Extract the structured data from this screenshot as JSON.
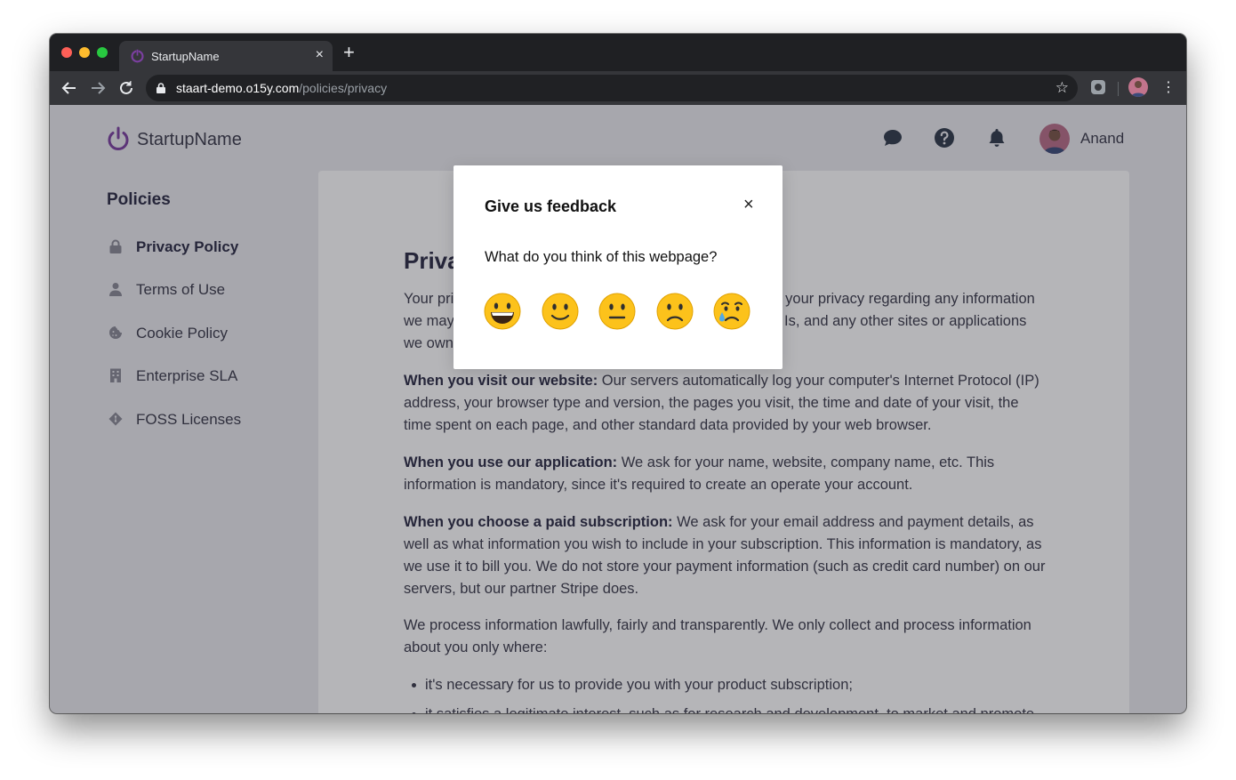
{
  "browser": {
    "tab_title": "StartupName",
    "url_domain": "staart-demo.o15y.com",
    "url_path": "/policies/privacy",
    "new_tab_label": "+",
    "close_tab_label": "×"
  },
  "header": {
    "brand": "StartupName",
    "user_name": "Anand",
    "icons": [
      "chat-icon",
      "help-icon",
      "bell-icon"
    ]
  },
  "sidebar": {
    "title": "Policies",
    "items": [
      {
        "label": "Privacy Policy",
        "icon": "lock-icon",
        "active": true
      },
      {
        "label": "Terms of Use",
        "icon": "user-icon",
        "active": false
      },
      {
        "label": "Cookie Policy",
        "icon": "cookie-icon",
        "active": false
      },
      {
        "label": "Enterprise SLA",
        "icon": "building-icon",
        "active": false
      },
      {
        "label": "FOSS Licenses",
        "icon": "git-icon",
        "active": false
      }
    ]
  },
  "document": {
    "title_visible": "Priva",
    "intro_lines": [
      "Your pri",
      "we may",
      "we own"
    ],
    "intro_right_lines": [
      "t your privacy regarding any information",
      "Is, and any other sites or applications"
    ],
    "sections": [
      {
        "heading": "When you visit our website:",
        "text": " Our servers automatically log your computer's Internet Protocol (IP) address, your browser type and version, the pages you visit, the time and date of your visit, the time spent on each page, and other standard data provided by your web browser."
      },
      {
        "heading": "When you use our application:",
        "text": " We ask for your name, website, company name, etc. This information is mandatory, since it's required to create an operate your account."
      },
      {
        "heading": "When you choose a paid subscription:",
        "text": " We ask for your email address and payment details, as well as what information you wish to include in your subscription. This information is mandatory, as we use it to bill you. We do not store your payment information (such as credit card number) on our servers, but our partner Stripe does."
      }
    ],
    "process_text": "We process information lawfully, fairly and transparently. We only collect and process information about you only where:",
    "bullets": [
      "it's necessary for us to provide you with your product subscription;",
      "it satisfies a legitimate interest, such as for research and development, to market and promote"
    ]
  },
  "feedback_modal": {
    "title": "Give us feedback",
    "close_label": "×",
    "question": "What do you think of this webpage?",
    "options": [
      "grinning-face",
      "slightly-smiling-face",
      "neutral-face",
      "slightly-frowning-face",
      "crying-face"
    ]
  },
  "colors": {
    "brand": "#7b3fa0",
    "overlay": "#1e1e28",
    "text": "#3a3a4a"
  }
}
